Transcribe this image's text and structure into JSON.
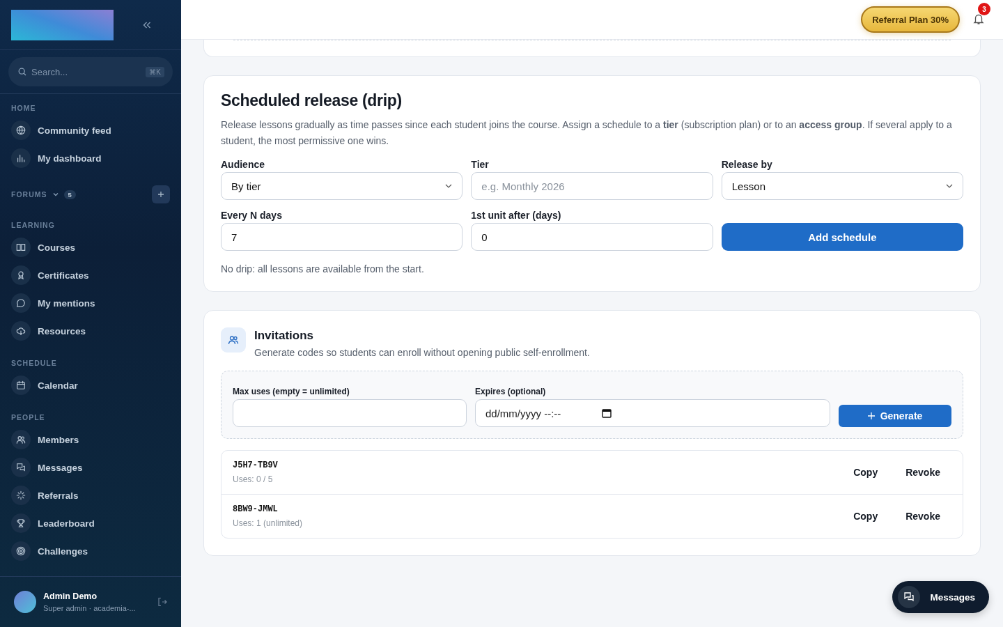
{
  "sidebar": {
    "search": {
      "placeholder": "Search...",
      "shortcut": "⌘K"
    },
    "sections": [
      {
        "kind": "group",
        "title": "HOME",
        "items": [
          {
            "label": "Community feed",
            "kind": "globe"
          },
          {
            "label": "My dashboard",
            "kind": "chart"
          }
        ]
      },
      {
        "kind": "forum_header",
        "title": "FORUMS",
        "count": "5"
      },
      {
        "kind": "group",
        "title": "LEARNING",
        "items": [
          {
            "label": "Courses",
            "kind": "book"
          },
          {
            "label": "Certificates",
            "kind": "award"
          },
          {
            "label": "My mentions",
            "kind": "bubble"
          },
          {
            "label": "Resources",
            "kind": "cloud"
          }
        ]
      },
      {
        "kind": "group",
        "title": "SCHEDULE",
        "items": [
          {
            "label": "Calendar",
            "kind": "calendar"
          }
        ]
      },
      {
        "kind": "group",
        "title": "PEOPLE",
        "items": [
          {
            "label": "Members",
            "kind": "users"
          },
          {
            "label": "Messages",
            "kind": "chats"
          },
          {
            "label": "Referrals",
            "kind": "spark"
          },
          {
            "label": "Leaderboard",
            "kind": "trophy"
          },
          {
            "label": "Challenges",
            "kind": "target"
          }
        ]
      }
    ],
    "user": {
      "name": "Admin Demo",
      "subtitle": "Super admin · academia-..."
    }
  },
  "header": {
    "referral_button": "Referral Plan 30%",
    "notification_count": "3"
  },
  "drip": {
    "title": "Scheduled release (drip)",
    "description": "Release lessons gradually as time passes since each student joins the course. Assign a schedule to a **tier** (subscription plan) or to an **access group**. If several apply to a student, the most permissive one wins.",
    "fields": [
      {
        "kind": "select",
        "label": "Audience",
        "value": "By tier"
      },
      {
        "kind": "input",
        "label": "Tier",
        "placeholder": "e.g. Monthly 2026"
      },
      {
        "kind": "select",
        "label": "Release by",
        "value": "Lesson"
      },
      {
        "kind": "input",
        "label": "Every N days",
        "value": "7"
      },
      {
        "kind": "input",
        "label": "1st unit after (days)",
        "value": "0"
      },
      {
        "kind": "button",
        "label": "Add schedule"
      }
    ],
    "note": "No drip: all lessons are available from the start."
  },
  "invitations": {
    "title": "Invitations",
    "subtitle": "Generate codes so students can enroll without opening public self-enrollment.",
    "max_uses_label": "Max uses (empty = unlimited)",
    "expires_label": "Expires (optional)",
    "expires_placeholder": "dd/mm/yyyy --:--",
    "generate_button": "Generate",
    "codes": [
      {
        "code": "J5H7-TB9V",
        "uses": "Uses: 0 / 5",
        "actions": [
          "Copy",
          "Revoke"
        ]
      },
      {
        "code": "8BW9-JMWL",
        "uses": "Uses: 1 (unlimited)",
        "actions": [
          "Copy",
          "Revoke"
        ]
      }
    ]
  },
  "floating_button": "Messages"
}
